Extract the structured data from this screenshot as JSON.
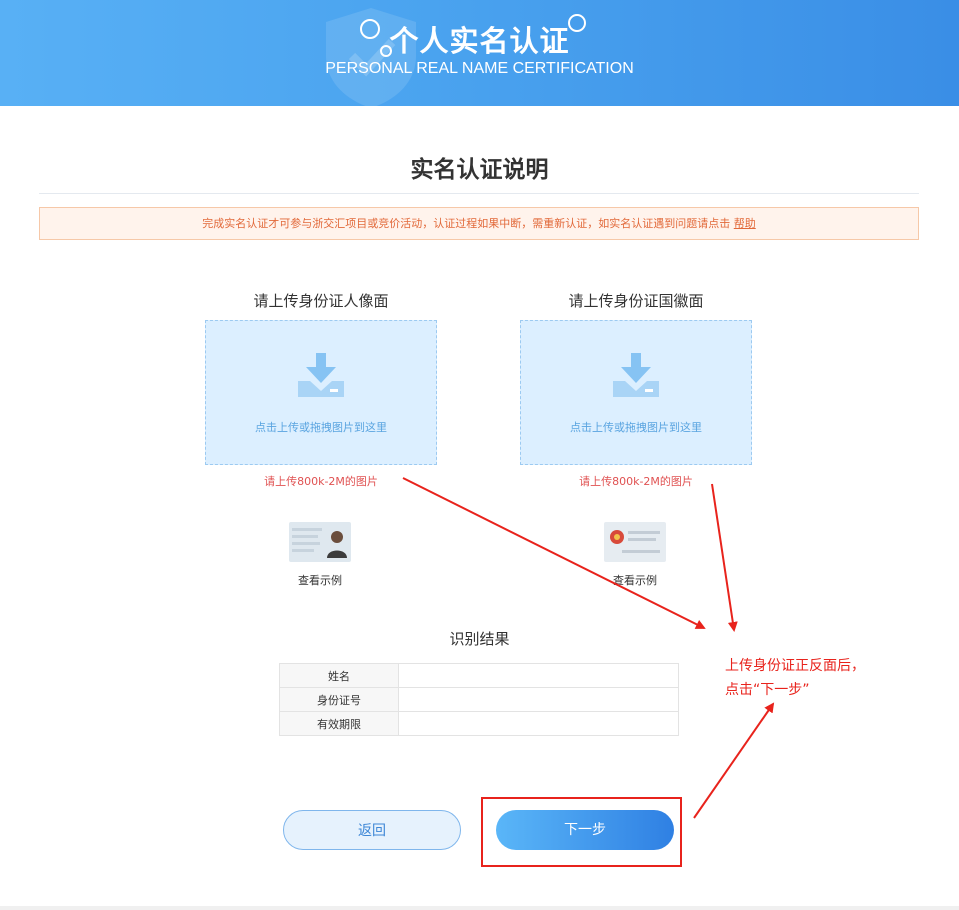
{
  "banner": {
    "title": "个人实名认证",
    "subtitle": "PERSONAL REAL NAME CERTIFICATION"
  },
  "section": {
    "title": "实名认证说明"
  },
  "notice": {
    "text": "完成实名认证才可参与浙交汇项目或竞价活动，认证过程如果中断，需重新认证，如实名认证遇到问题请点击 ",
    "link": "帮助"
  },
  "uploads": [
    {
      "label": "请上传身份证人像面",
      "dropzone_text": "点击上传或拖拽图片到这里",
      "hint": "请上传800k-2M的图片",
      "sample_label": "查看示例"
    },
    {
      "label": "请上传身份证国徽面",
      "dropzone_text": "点击上传或拖拽图片到这里",
      "hint": "请上传800k-2M的图片",
      "sample_label": "查看示例"
    }
  ],
  "result": {
    "title": "识别结果",
    "rows": [
      {
        "label": "姓名",
        "value": ""
      },
      {
        "label": "身份证号",
        "value": ""
      },
      {
        "label": "有效期限",
        "value": ""
      }
    ]
  },
  "annotation": {
    "line1": "上传身份证正反面后，",
    "line2": "点击“下一步”"
  },
  "buttons": {
    "back": "返回",
    "next": "下一步"
  },
  "colors": {
    "accent": "#3a8ee6",
    "annotation_red": "#e8231c",
    "notice_text": "#e2693a",
    "hint_red": "#e05252"
  },
  "icons": {
    "banner_decoration": "shield-icon",
    "dropzone": "upload-tray-icon"
  }
}
